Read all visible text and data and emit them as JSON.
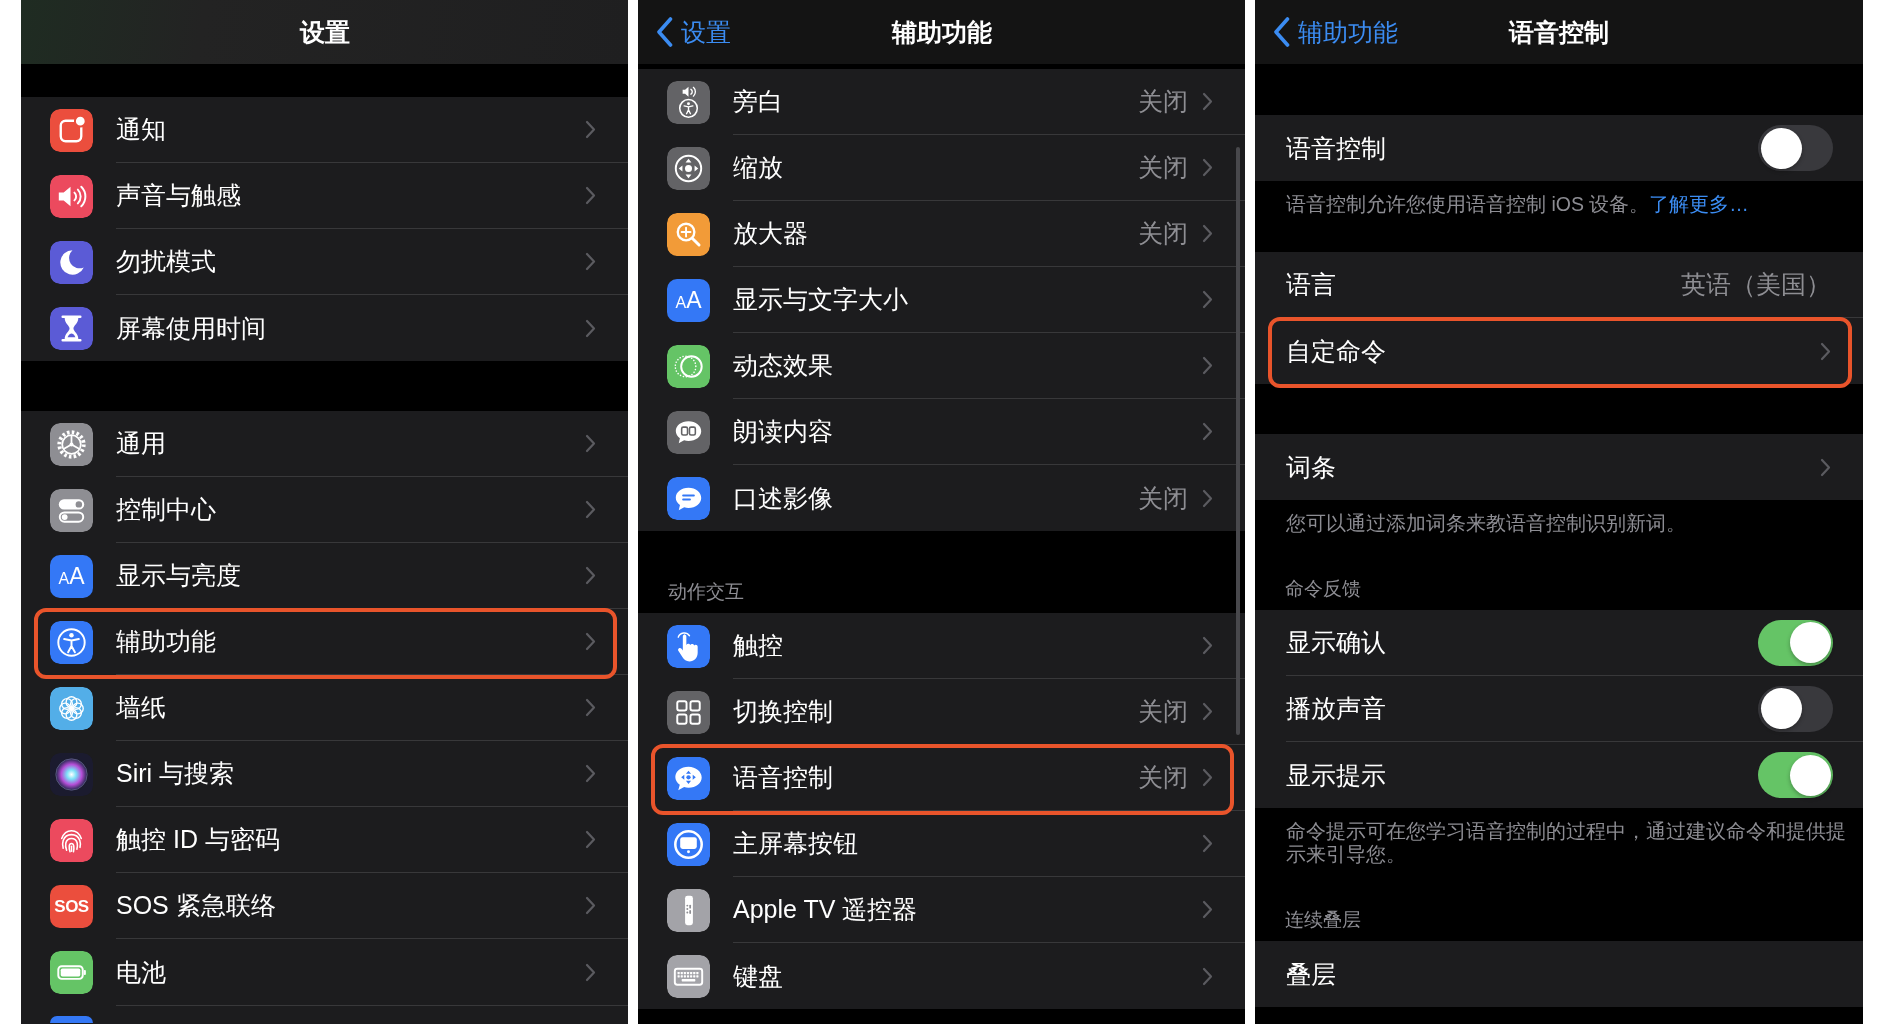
{
  "panels": [
    {
      "nav": {
        "title": "设置"
      },
      "sections": [
        {
          "rows": [
            {
              "kind": "link",
              "label": "通知",
              "highlighted": false
            },
            {
              "kind": "link",
              "label": "声音与触感",
              "highlighted": false
            },
            {
              "kind": "link",
              "label": "勿扰模式",
              "highlighted": false
            },
            {
              "kind": "link",
              "label": "屏幕使用时间",
              "highlighted": false
            }
          ]
        },
        {
          "rows": [
            {
              "kind": "link",
              "label": "通用",
              "highlighted": false
            },
            {
              "kind": "link",
              "label": "控制中心",
              "highlighted": false
            },
            {
              "kind": "link",
              "label": "显示与亮度",
              "icon_text": "AA",
              "highlighted": false
            },
            {
              "kind": "link",
              "label": "辅助功能",
              "highlighted": true
            },
            {
              "kind": "link",
              "label": "墙纸",
              "highlighted": false
            },
            {
              "kind": "link",
              "label": "Siri 与搜索",
              "highlighted": false
            },
            {
              "kind": "link",
              "label": "触控 ID 与密码",
              "highlighted": false
            },
            {
              "kind": "link",
              "label": "SOS 紧急联络",
              "icon_text": "SOS",
              "highlighted": false
            },
            {
              "kind": "link",
              "label": "电池",
              "highlighted": false
            }
          ]
        }
      ]
    },
    {
      "nav": {
        "back": "设置",
        "title": "辅助功能"
      },
      "sections": [
        {
          "rows": [
            {
              "kind": "link",
              "label": "旁白",
              "value": "关闭",
              "highlighted": false
            },
            {
              "kind": "link",
              "label": "缩放",
              "value": "关闭",
              "highlighted": false
            },
            {
              "kind": "link",
              "label": "放大器",
              "value": "关闭",
              "highlighted": false
            },
            {
              "kind": "link",
              "label": "显示与文字大小",
              "icon_text": "AA",
              "highlighted": false
            },
            {
              "kind": "link",
              "label": "动态效果",
              "highlighted": false
            },
            {
              "kind": "link",
              "label": "朗读内容",
              "highlighted": false
            },
            {
              "kind": "link",
              "label": "口述影像",
              "value": "关闭",
              "highlighted": false
            }
          ]
        },
        {
          "header": "动作交互",
          "rows": [
            {
              "kind": "link",
              "label": "触控",
              "highlighted": false
            },
            {
              "kind": "link",
              "label": "切换控制",
              "value": "关闭",
              "highlighted": false
            },
            {
              "kind": "link",
              "label": "语音控制",
              "value": "关闭",
              "highlighted": true
            },
            {
              "kind": "link",
              "label": "主屏幕按钮",
              "highlighted": false
            },
            {
              "kind": "link",
              "label": "Apple TV 遥控器",
              "highlighted": false
            },
            {
              "kind": "link",
              "label": "键盘",
              "highlighted": false
            }
          ]
        }
      ]
    },
    {
      "nav": {
        "back": "辅助功能",
        "title": "语音控制"
      },
      "sections": [
        {
          "rows": [
            {
              "kind": "toggle",
              "label": "语音控制",
              "on": false,
              "highlighted": false
            }
          ],
          "footer": "语音控制允许您使用语音控制 iOS 设备。",
          "footer_link": "了解更多…"
        },
        {
          "rows": [
            {
              "kind": "value",
              "label": "语言",
              "value": "英语（美国）",
              "highlighted": false
            },
            {
              "kind": "link",
              "label": "自定命令",
              "highlighted": true
            }
          ]
        },
        {
          "rows": [
            {
              "kind": "link",
              "label": "词条",
              "highlighted": false
            }
          ],
          "footer": "您可以通过添加词条来教语音控制识别新词。"
        },
        {
          "header": "命令反馈",
          "rows": [
            {
              "kind": "toggle",
              "label": "显示确认",
              "on": true,
              "highlighted": false
            },
            {
              "kind": "toggle",
              "label": "播放声音",
              "on": false,
              "highlighted": false
            },
            {
              "kind": "toggle",
              "label": "显示提示",
              "on": true,
              "highlighted": false
            }
          ],
          "footer": "命令提示可在您学习语音控制的过程中，通过建议命令和提供提示来引导您。"
        },
        {
          "header": "连续叠层",
          "rows": [
            {
              "kind": "plain",
              "label": "叠层",
              "highlighted": false
            }
          ]
        }
      ]
    }
  ]
}
